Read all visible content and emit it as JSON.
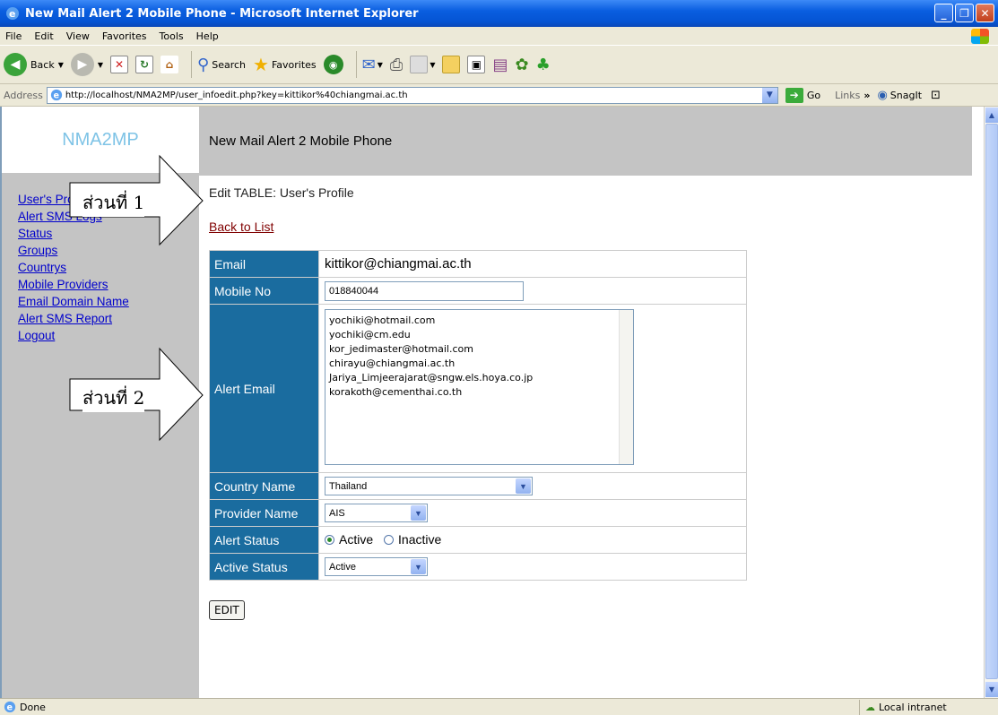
{
  "window": {
    "title": "New Mail Alert 2 Mobile Phone - Microsoft Internet Explorer"
  },
  "menu": [
    "File",
    "Edit",
    "View",
    "Favorites",
    "Tools",
    "Help"
  ],
  "toolbar": {
    "back_label": "Back",
    "search_label": "Search",
    "favorites_label": "Favorites"
  },
  "address": {
    "label": "Address",
    "url": "http://localhost/NMA2MP/user_infoedit.php?key=kittikor%40chiangmai.ac.th",
    "go_label": "Go",
    "links_label": "Links",
    "snagit_label": "SnagIt"
  },
  "sidebar": {
    "brand": "NMA2MP",
    "items": [
      {
        "label": "User's Profile"
      },
      {
        "label": "Alert SMS Logs"
      },
      {
        "label": "Status"
      },
      {
        "label": "Groups"
      },
      {
        "label": "Countrys"
      },
      {
        "label": "Mobile Providers"
      },
      {
        "label": "Email Domain Name"
      },
      {
        "label": "Alert SMS Report"
      },
      {
        "label": "Logout"
      }
    ]
  },
  "header": {
    "title": "New Mail Alert 2 Mobile Phone"
  },
  "main": {
    "heading": "Edit TABLE: User's Profile",
    "back_link": "Back to List",
    "form": {
      "email_label": "Email",
      "email_value": "kittikor@chiangmai.ac.th",
      "mobile_label": "Mobile No",
      "mobile_value": "018840044",
      "alert_email_label": "Alert Email",
      "alert_email_value": "yochiki@hotmail.com\nyochiki@cm.edu\nkor_jedimaster@hotmail.com\nchirayu@chiangmai.ac.th\nJariya_Limjeerajarat@sngw.els.hoya.co.jp\nkorakoth@cementhai.co.th",
      "country_label": "Country Name",
      "country_value": "Thailand",
      "provider_label": "Provider Name",
      "provider_value": "AIS",
      "alert_status_label": "Alert Status",
      "alert_status_active": "Active",
      "alert_status_inactive": "Inactive",
      "active_status_label": "Active Status",
      "active_status_value": "Active"
    },
    "edit_button": "EDIT"
  },
  "callouts": {
    "part1": "ส่วนที่ 1",
    "part2": "ส่วนที่ 2"
  },
  "status": {
    "text": "Done",
    "zone": "Local intranet"
  }
}
